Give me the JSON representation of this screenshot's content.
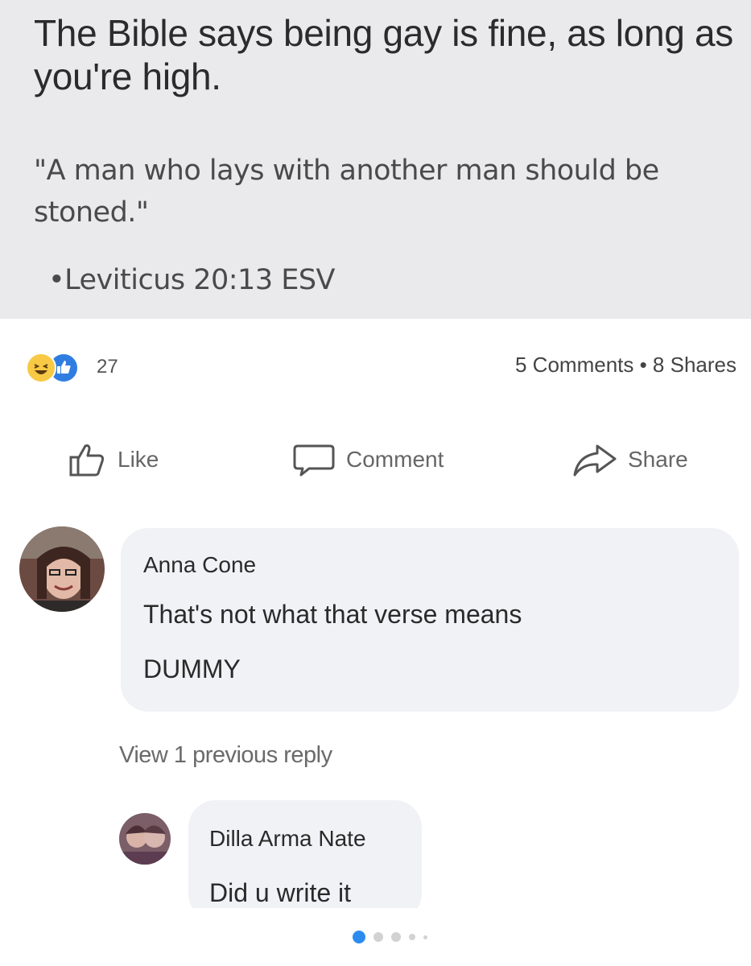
{
  "post": {
    "headline": "The Bible says being gay is fine, as long as you're high.",
    "quote": "\"A man who lays with another man should be stoned.\"",
    "citation": "•Leviticus 20:13 ESV"
  },
  "reactions": {
    "icons": [
      "haha-reaction-icon",
      "like-reaction-icon"
    ],
    "count": "27"
  },
  "stats": {
    "summary": "5 Comments • 8 Shares"
  },
  "actions": {
    "like": "Like",
    "comment": "Comment",
    "share": "Share"
  },
  "comments": [
    {
      "author": "Anna Cone",
      "line1": "That's not what that verse means",
      "line2": "DUMMY"
    },
    {
      "author": "Dilla Arma Nate",
      "line1": "Did u write it"
    }
  ],
  "view_previous": "View 1 previous reply",
  "carousel": {
    "dot_count": 5,
    "active_index": 0
  },
  "colors": {
    "post_image_bg": "#eae9ec",
    "comment_bubble": "#f1f2f5",
    "like_blue": "#2f7de1",
    "haha_yellow": "#f7c944",
    "active_dot": "#2b8cf0"
  }
}
